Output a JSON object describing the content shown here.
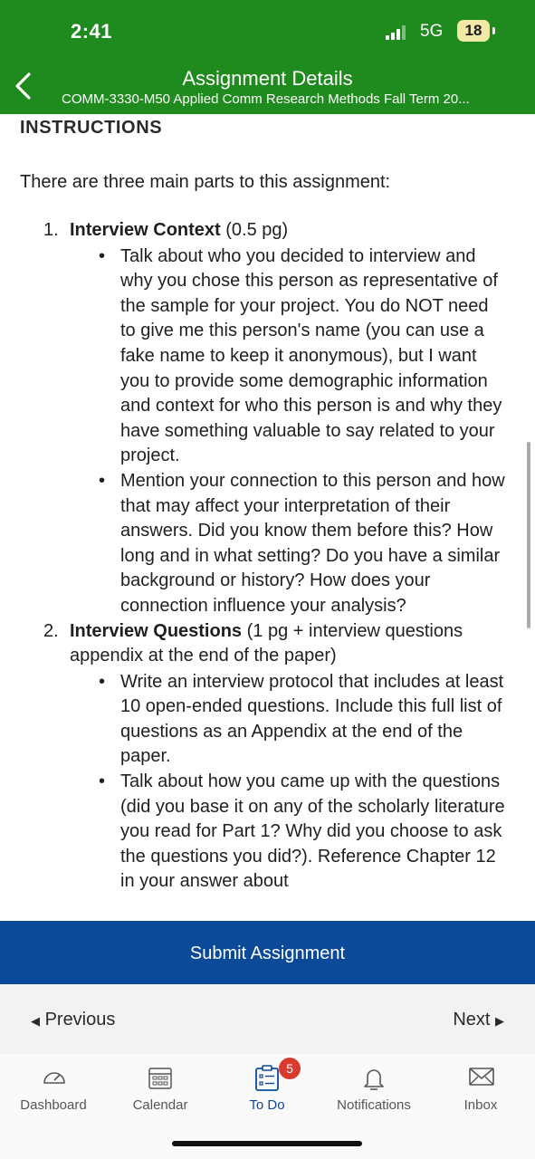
{
  "status": {
    "time": "2:41",
    "network": "5G",
    "battery": "18"
  },
  "header": {
    "title": "Assignment Details",
    "subtitle": "COMM-3330-M50 Applied Comm Research Methods Fall Term 20..."
  },
  "content": {
    "section_heading": "INSTRUCTIONS",
    "intro": "There are three main parts to this assignment:",
    "parts": [
      {
        "number": "1.",
        "title": "Interview Context",
        "meta": " (0.5 pg)",
        "bullets": [
          "Talk about who you decided to interview and why you chose this person as representative of the sample for your project. You do NOT need to give me this person's name (you can use a fake name to keep it anonymous), but I want you to provide some demographic information and context for who this person is and why they have something valuable to say related to your project.",
          "Mention your connection to this person and how that may affect your interpretation of their answers. Did you know them before this? How long and in what setting? Do you have a similar background or history? How does your connection influence your analysis?"
        ]
      },
      {
        "number": "2.",
        "title": "Interview Questions",
        "meta": " (1 pg + interview questions appendix at the end of the paper)",
        "bullets": [
          "Write an interview protocol that includes at least 10 open-ended questions. Include this full list of questions as an Appendix at the end of the paper.",
          "Talk about how you came up with the questions (did you base it on any of the scholarly literature you read for Part 1? Why did you choose to ask the questions you did?). Reference Chapter 12 in your answer about"
        ]
      }
    ]
  },
  "actions": {
    "submit_label": "Submit Assignment",
    "previous_label": "Previous",
    "next_label": "Next"
  },
  "tabs": [
    {
      "label": "Dashboard",
      "icon": "dashboard-icon"
    },
    {
      "label": "Calendar",
      "icon": "calendar-icon"
    },
    {
      "label": "To Do",
      "icon": "todo-icon",
      "badge": "5"
    },
    {
      "label": "Notifications",
      "icon": "bell-icon"
    },
    {
      "label": "Inbox",
      "icon": "inbox-icon"
    }
  ],
  "colors": {
    "header": "#1f8a1d",
    "submit_bar": "#0a4a99",
    "badge": "#d83a2f"
  }
}
